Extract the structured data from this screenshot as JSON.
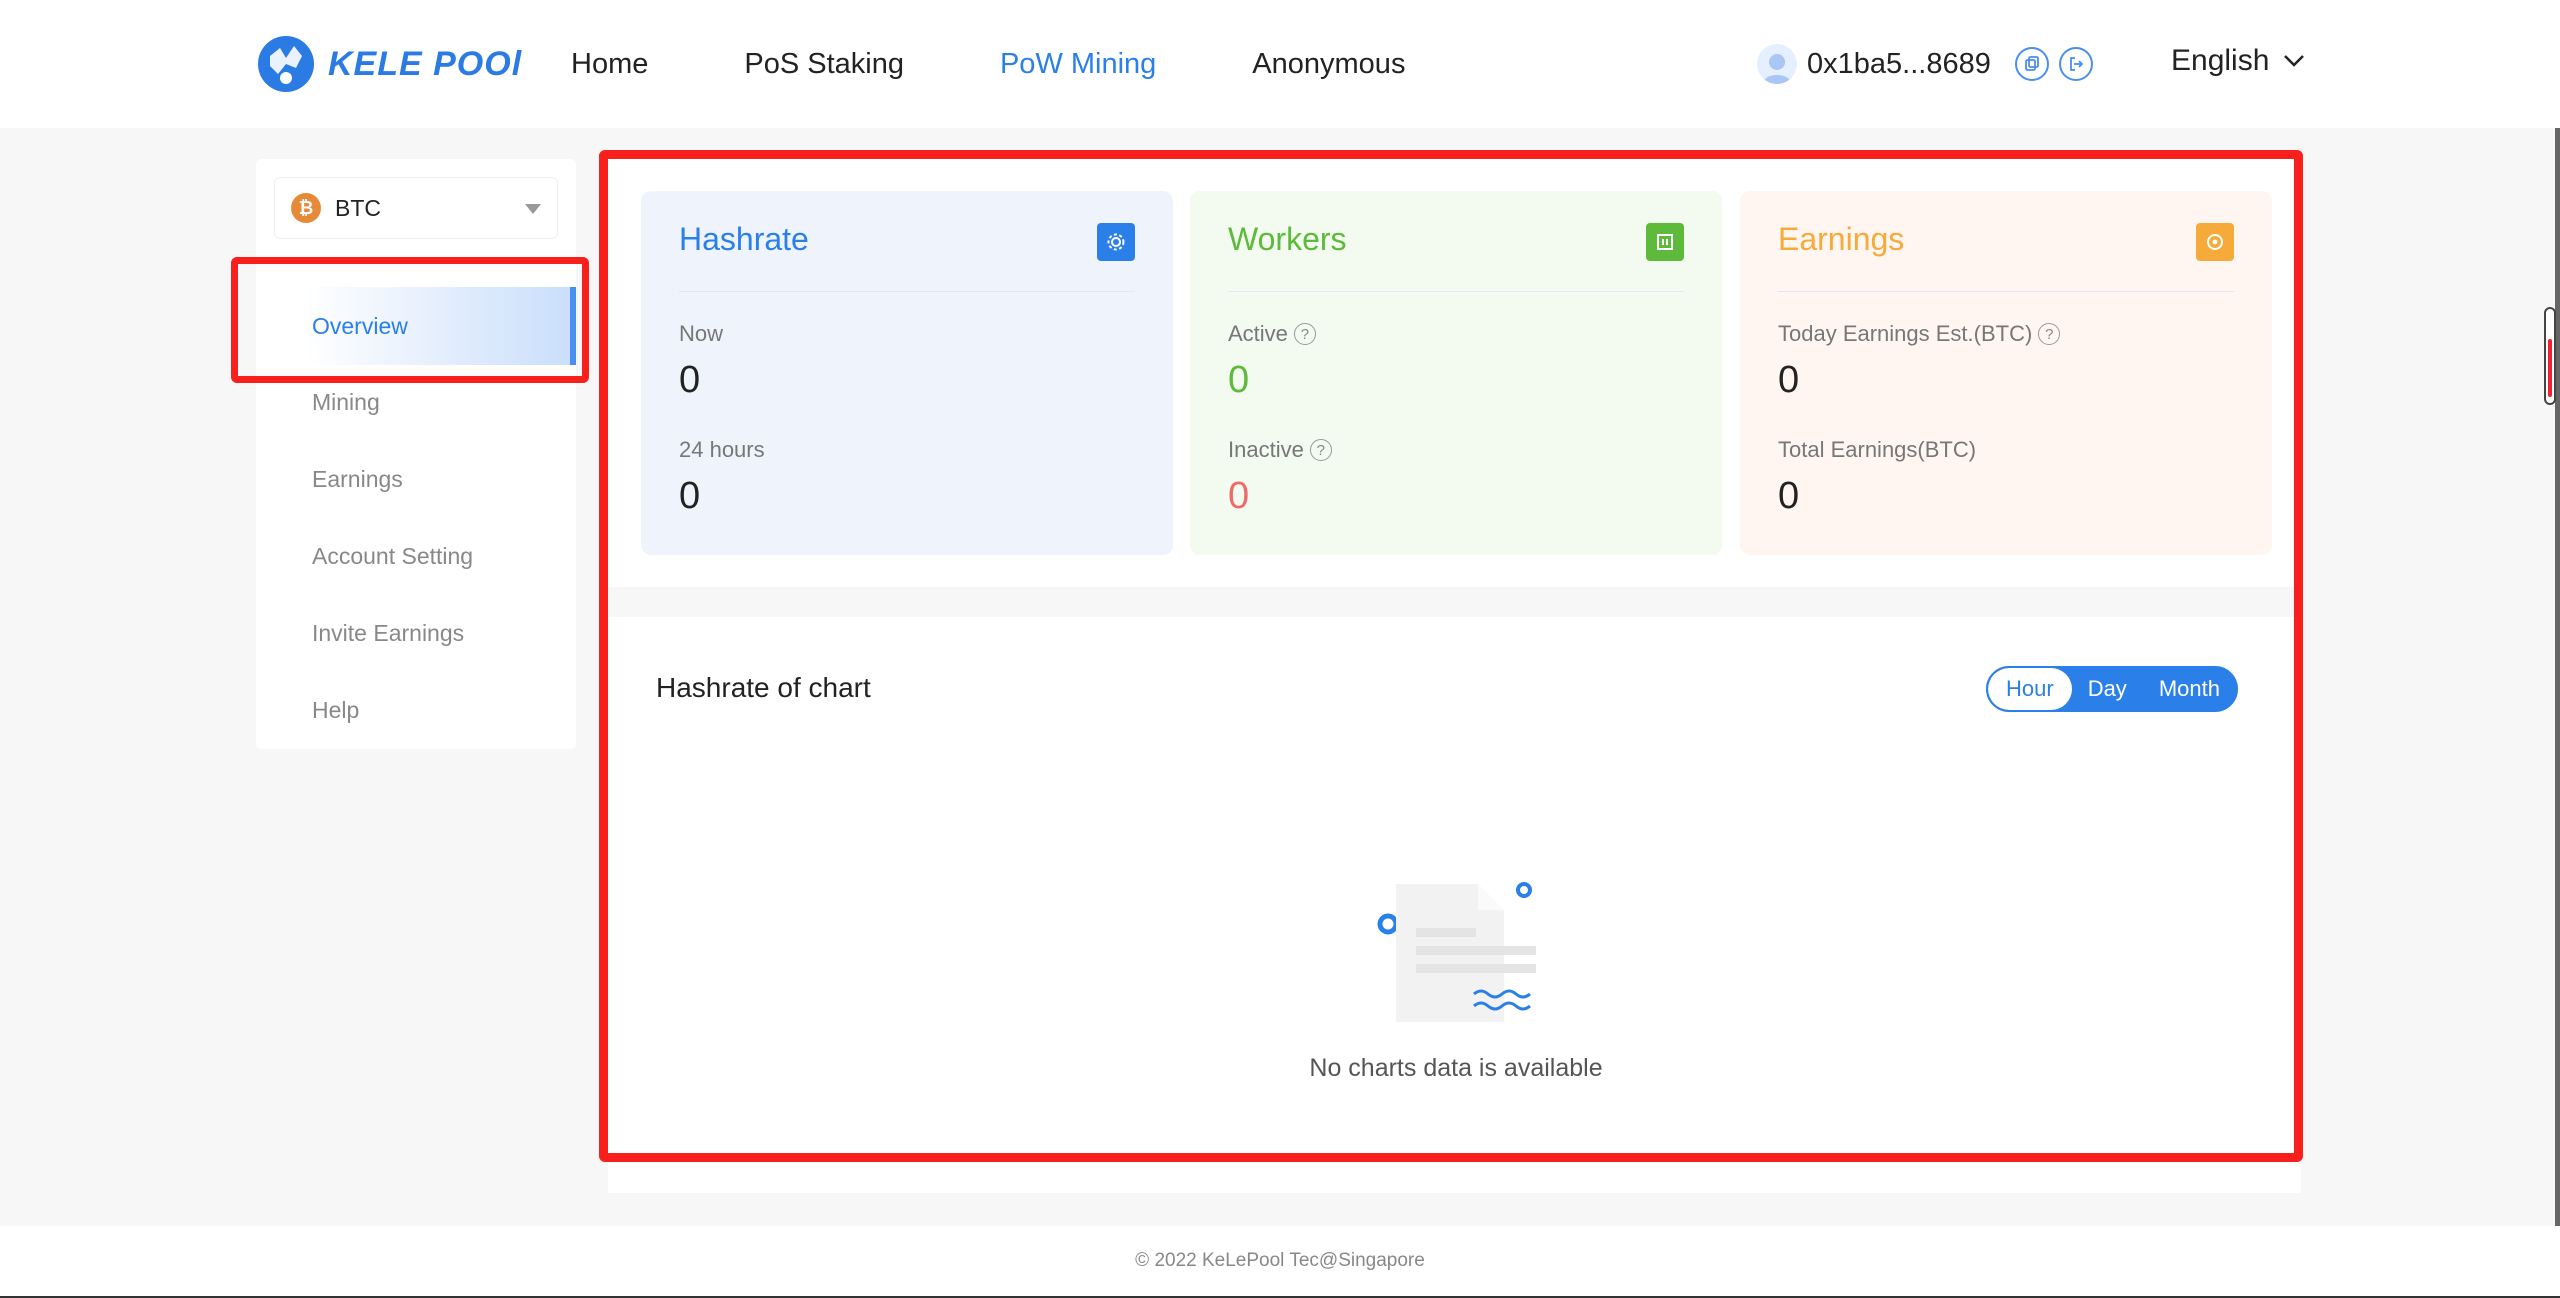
{
  "header": {
    "logo_text": "KELE POOl",
    "nav": [
      "Home",
      "PoS Staking",
      "PoW Mining",
      "Anonymous"
    ],
    "active_nav": "PoW Mining",
    "wallet_address": "0x1ba5...8689",
    "language": "English"
  },
  "sidebar": {
    "coin": "BTC",
    "items": [
      {
        "label": "Overview",
        "active": true
      },
      {
        "label": "Mining"
      },
      {
        "label": "Earnings"
      },
      {
        "label": "Account Setting"
      },
      {
        "label": "Invite Earnings"
      },
      {
        "label": "Help"
      }
    ]
  },
  "cards": {
    "hashrate": {
      "title": "Hashrate",
      "now_label": "Now",
      "now_value": "0",
      "day_label": "24 hours",
      "day_value": "0"
    },
    "workers": {
      "title": "Workers",
      "active_label": "Active",
      "active_value": "0",
      "inactive_label": "Inactive",
      "inactive_value": "0"
    },
    "earnings": {
      "title": "Earnings",
      "today_label": "Today Earnings Est.(BTC)",
      "today_value": "0",
      "total_label": "Total Earnings(BTC)",
      "total_value": "0"
    }
  },
  "chart": {
    "title": "Hashrate of chart",
    "ranges": [
      "Hour",
      "Day",
      "Month"
    ],
    "active_range": "Hour",
    "empty_text": "No charts data is available"
  },
  "footer": {
    "copyright": "© 2022 KeLePool Tec@Singapore"
  },
  "colors": {
    "accent": "#2a7fe8",
    "green": "#5dba3a",
    "orange": "#f6aa3a",
    "red": "#ef6a66",
    "highlight": "#f8201c"
  }
}
